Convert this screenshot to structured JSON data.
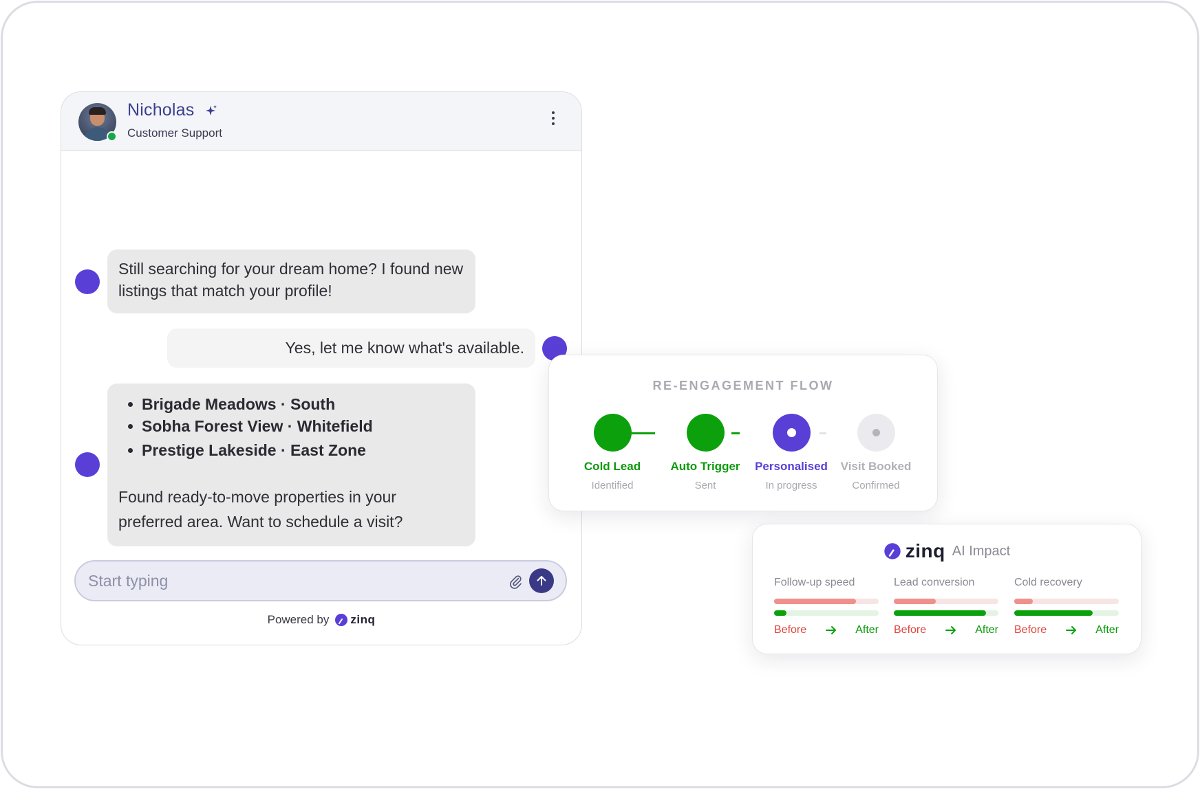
{
  "chat": {
    "agent_name": "Nicholas",
    "agent_role": "Customer Support",
    "messages": {
      "bot_greeting": "Still searching for your dream home? I found new listings that match your profile!",
      "user_reply": "Yes, let me know what's available.",
      "bot_listings": [
        "Brigade Meadows · South",
        "Sobha Forest View · Whitefield",
        "Prestige Lakeside · East Zone"
      ],
      "bot_followup": "Found ready-to-move properties in your preferred area. Want to schedule a visit?"
    },
    "composer": {
      "placeholder": "Start typing"
    },
    "powered_by": "Powered by",
    "brand": "zinq"
  },
  "flow": {
    "title": "RE-ENGAGEMENT FLOW",
    "steps": [
      {
        "label": "Cold Lead",
        "sub": "Identified",
        "status": "done"
      },
      {
        "label": "Auto Trigger",
        "sub": "Sent",
        "status": "done"
      },
      {
        "label": "Personalised",
        "sub": "In progress",
        "status": "active"
      },
      {
        "label": "Visit Booked",
        "sub": "Confirmed",
        "status": "pending"
      }
    ]
  },
  "impact": {
    "brand": "zinq",
    "title": "AI Impact",
    "metrics": [
      {
        "label": "Follow-up speed",
        "before": 0.78,
        "after": 0.12,
        "before_label": "Before",
        "after_label": "After"
      },
      {
        "label": "Lead conversion",
        "before": 0.4,
        "after": 0.88,
        "before_label": "Before",
        "after_label": "After"
      },
      {
        "label": "Cold recovery",
        "before": 0.18,
        "after": 0.75,
        "before_label": "Before",
        "after_label": "After"
      }
    ]
  },
  "colors": {
    "accent": "#5a3fd6",
    "brand_navy": "#3a3986",
    "success": "#0ca10c",
    "before_red": "#e0453d"
  },
  "icons": [
    "sparkle-icon",
    "more-vertical-icon",
    "paperclip-icon",
    "arrow-up-icon",
    "arrow-right-icon",
    "zinq-logo-icon"
  ]
}
